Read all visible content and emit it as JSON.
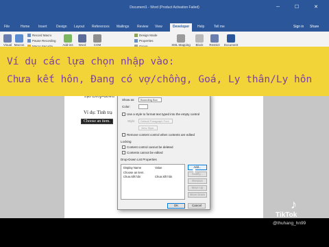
{
  "window": {
    "title": "Document1 - Word (Product Activation Failed)",
    "controls": "─ ☐ ✕"
  },
  "tabs": [
    "File",
    "Home",
    "Insert",
    "Design",
    "Layout",
    "References",
    "Mailings",
    "Review",
    "View",
    "Developer",
    "Help"
  ],
  "active_tab": "Developer",
  "header_right": {
    "tell_me": "Tell me",
    "sign_in": "Sign in",
    "share": "Share"
  },
  "ribbon": {
    "visual_basic": "Visual Basic",
    "macros": "Macros",
    "record_macro": "Record Macro",
    "pause_recording": "Pause Recording",
    "macro_security": "Macro Security",
    "add_ins": "Add-ins",
    "word_add_ins": "Word Add-ins",
    "com_add_ins": "COM Add-ins",
    "design_mode": "Design Mode",
    "properties": "Properties",
    "group": "Group",
    "xml_mapping": "XML Mapping Pane",
    "block_authors": "Block Authors",
    "restrict_editing": "Restrict Editing",
    "document_template": "Document Template"
  },
  "document": {
    "line1": "Tạo Drop-down",
    "line2": "Ví dụ: Tình trạ",
    "control_text": "Choose an item."
  },
  "dialog": {
    "show_as_label": "Show as:",
    "show_as_value": "Bounding Box",
    "color_label": "Color:",
    "use_style_label": "Use a style to format text typed into the empty control",
    "style_label": "Style:",
    "style_value": "Default Paragraph Font",
    "new_style_button": "New Style...",
    "remove_control_label": "Remove content control when contents are edited",
    "locking_header": "Locking",
    "cannot_delete_label": "Content control cannot be deleted",
    "cannot_edit_label": "Contents cannot be edited",
    "list_header": "Drop-Down List Properties",
    "col_display": "Display Name",
    "col_value": "Value",
    "rows": [
      {
        "display": "Choose an item.",
        "value": ""
      },
      {
        "display": "Chưa kết hôn",
        "value": "Chưa kết hôn"
      }
    ],
    "add_button": "Add...",
    "modify_button": "Modify...",
    "remove_button": "Remove",
    "move_up_button": "Move Up",
    "move_down_button": "Move Down",
    "ok_button": "OK",
    "cancel_button": "Cancel"
  },
  "banner": {
    "line1": "Ví dụ các lựa chọn nhập vào:",
    "line2": "Chưa kết hôn, Đang có vợ/chồng, Goá, Ly thân/Ly hôn"
  },
  "watermark": {
    "brand": "TikTok",
    "handle": "@thuhang_hn99"
  },
  "colors": {
    "word_blue": "#2b579a",
    "banner_yellow": "#f3d438",
    "banner_text": "#7a3fa6"
  }
}
